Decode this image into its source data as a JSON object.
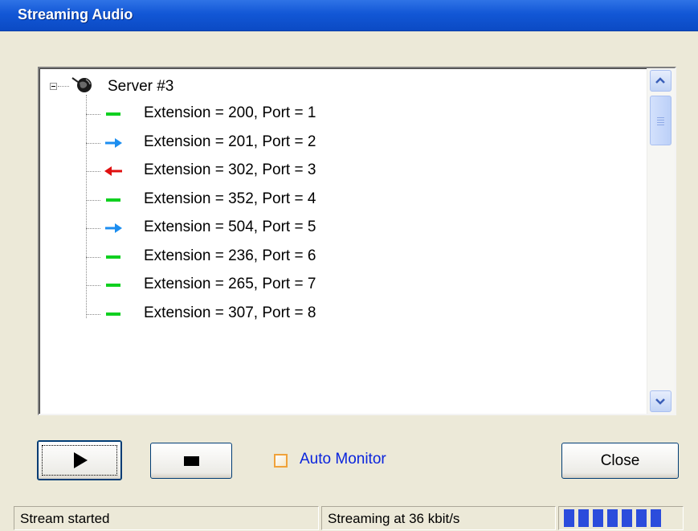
{
  "window": {
    "title": "Streaming Audio"
  },
  "tree": {
    "root": {
      "label": "Server #3",
      "icon": "server-globe-icon",
      "expanded": true
    },
    "nodes": [
      {
        "label": "Extension = 200,  Port = 1",
        "status": "idle",
        "icon": "dash-green-icon"
      },
      {
        "label": "Extension = 201,  Port = 2",
        "status": "outgoing",
        "icon": "arrow-right-blue-icon"
      },
      {
        "label": "Extension = 302,  Port = 3",
        "status": "incoming",
        "icon": "arrow-left-red-icon"
      },
      {
        "label": "Extension = 352,  Port = 4",
        "status": "idle",
        "icon": "dash-green-icon"
      },
      {
        "label": "Extension = 504,  Port = 5",
        "status": "outgoing",
        "icon": "arrow-right-blue-icon"
      },
      {
        "label": "Extension = 236,  Port = 6",
        "status": "idle",
        "icon": "dash-green-icon"
      },
      {
        "label": "Extension = 265,  Port = 7",
        "status": "idle",
        "icon": "dash-green-icon"
      },
      {
        "label": "Extension = 307,  Port = 8",
        "status": "idle",
        "icon": "dash-green-icon"
      }
    ]
  },
  "controls": {
    "play_icon": "play-icon",
    "stop_icon": "stop-icon",
    "auto_monitor_label": "Auto Monitor",
    "auto_monitor_checked": false,
    "close_label": "Close"
  },
  "statusbar": {
    "left": "Stream started",
    "middle": "Streaming at 36 kbit/s",
    "level_segments": 7
  },
  "colors": {
    "title_bar": "#0b4ac4",
    "idle": "#10d020",
    "outgoing": "#1c8ef0",
    "incoming": "#e01010",
    "link": "#0a24dd",
    "level": "#2b4cdc"
  }
}
